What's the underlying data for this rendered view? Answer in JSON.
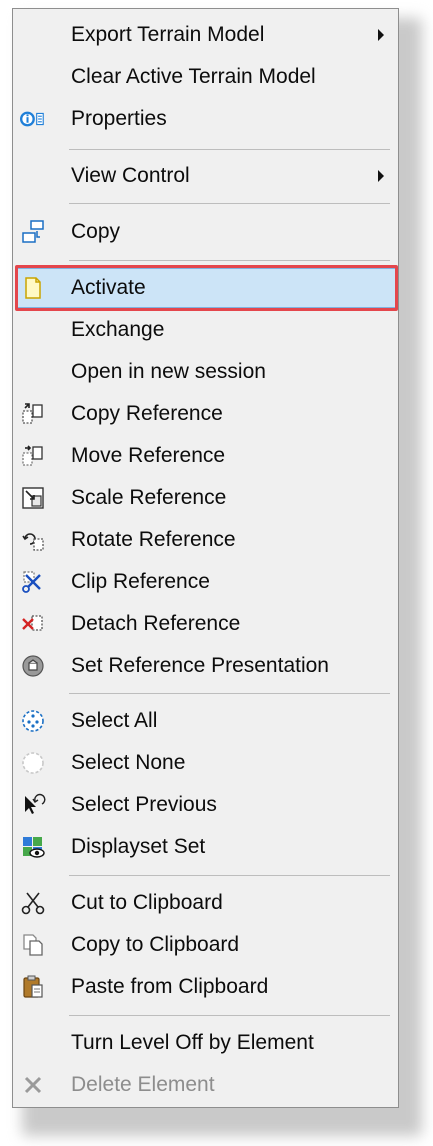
{
  "menu": {
    "items": [
      {
        "key": "export-terrain-model",
        "label": "Export Terrain Model",
        "submenu": true,
        "icon": ""
      },
      {
        "key": "clear-active-terrain-model",
        "label": "Clear Active Terrain Model",
        "icon": ""
      },
      {
        "key": "properties",
        "label": "Properties",
        "icon": "properties-icon"
      },
      {
        "key": "view-control",
        "label": "View Control",
        "submenu": true,
        "icon": ""
      },
      {
        "key": "copy",
        "label": "Copy",
        "icon": "copy-icon"
      },
      {
        "key": "activate",
        "label": "Activate",
        "icon": "activate-icon",
        "highlighted": true
      },
      {
        "key": "exchange",
        "label": "Exchange",
        "icon": ""
      },
      {
        "key": "open-in-new-session",
        "label": "Open in new session",
        "icon": ""
      },
      {
        "key": "copy-reference",
        "label": "Copy Reference",
        "icon": "copy-reference-icon"
      },
      {
        "key": "move-reference",
        "label": "Move Reference",
        "icon": "move-reference-icon"
      },
      {
        "key": "scale-reference",
        "label": "Scale Reference",
        "icon": "scale-reference-icon"
      },
      {
        "key": "rotate-reference",
        "label": "Rotate Reference",
        "icon": "rotate-reference-icon"
      },
      {
        "key": "clip-reference",
        "label": "Clip Reference",
        "icon": "clip-reference-icon"
      },
      {
        "key": "detach-reference",
        "label": "Detach Reference",
        "icon": "detach-reference-icon"
      },
      {
        "key": "set-reference-presentation",
        "label": "Set Reference Presentation",
        "icon": "presentation-icon"
      },
      {
        "key": "select-all",
        "label": "Select All",
        "icon": "select-all-icon"
      },
      {
        "key": "select-none",
        "label": "Select None",
        "icon": "select-none-icon"
      },
      {
        "key": "select-previous",
        "label": "Select Previous",
        "icon": "select-previous-icon"
      },
      {
        "key": "displayset-set",
        "label": "Displayset Set",
        "icon": "displayset-icon"
      },
      {
        "key": "cut-to-clipboard",
        "label": "Cut to Clipboard",
        "icon": "scissors-icon"
      },
      {
        "key": "copy-to-clipboard",
        "label": "Copy to Clipboard",
        "icon": "copy-clipboard-icon"
      },
      {
        "key": "paste-from-clipboard",
        "label": "Paste from Clipboard",
        "icon": "paste-icon"
      },
      {
        "key": "turn-level-off",
        "label": "Turn Level Off by Element",
        "icon": ""
      },
      {
        "key": "delete-element",
        "label": "Delete Element",
        "icon": "delete-icon",
        "disabled": true
      }
    ]
  },
  "colors": {
    "menu_background": "#f0f0f0",
    "highlight_fill": "#cce4f7",
    "highlight_outline": "#e4464c",
    "disabled_text": "#8d8d8d"
  }
}
